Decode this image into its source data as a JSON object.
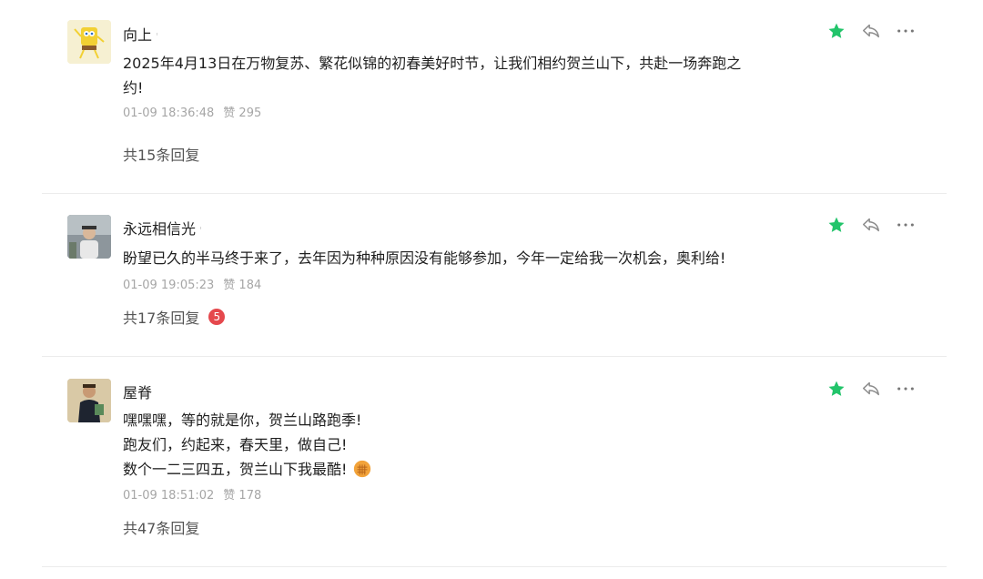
{
  "colors": {
    "star": "#22c46a",
    "badge": "#e5484d",
    "meta": "#a6a6a6"
  },
  "comments": [
    {
      "user": "向上",
      "avatar": "spongebob-avatar",
      "lines": [
        "2025年4月13日在万物复苏、繁花似锦的初春美好时节，让我们相约贺兰山下，共赴一场奔跑之",
        "约!"
      ],
      "time": "01-09 18:36:48",
      "likes": "赞 295",
      "replies": "共15条回复",
      "badge": ""
    },
    {
      "user": "永远相信光",
      "avatar": "photo-avatar",
      "lines": [
        "盼望已久的半马终于来了，去年因为种种原因没有能够参加，今年一定给我一次机会，奥利给!"
      ],
      "time": "01-09 19:05:23",
      "likes": "赞 184",
      "replies": "共17条回复",
      "badge": "5"
    },
    {
      "user": "屋脊",
      "avatar": "figure-avatar",
      "lines": [
        "嘿嘿嘿，等的就是你，贺兰山路跑季!",
        "跑友们，约起来，春天里，做自己!",
        "数个一二三四五，贺兰山下我最酷!"
      ],
      "time": "01-09 18:51:02",
      "likes": "赞 178",
      "replies": "共47条回复",
      "badge": ""
    }
  ]
}
